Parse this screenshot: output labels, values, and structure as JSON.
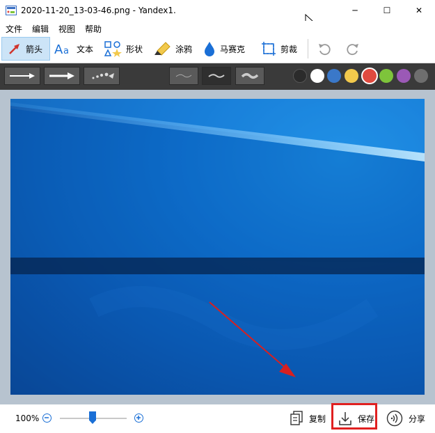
{
  "window": {
    "title": "2020-11-20_13-03-46.png - Yandex1.",
    "controls": {
      "minimize": "─",
      "maximize": "☐",
      "close": "✕"
    }
  },
  "menu": [
    {
      "label": "文件"
    },
    {
      "label": "编辑"
    },
    {
      "label": "视图"
    },
    {
      "label": "帮助"
    }
  ],
  "toolbar": {
    "tools": [
      {
        "label": "箭头",
        "icon": "arrow-tool-icon",
        "active": true
      },
      {
        "label": "文本",
        "icon": "text-tool-icon"
      },
      {
        "label": "形状",
        "icon": "shape-tool-icon"
      },
      {
        "label": "涂鸦",
        "icon": "marker-tool-icon"
      },
      {
        "label": "马赛克",
        "icon": "mosaic-tool-icon"
      },
      {
        "label": "剪裁",
        "icon": "crop-tool-icon"
      }
    ],
    "undo_icon": "undo-icon",
    "redo_icon": "redo-icon"
  },
  "options": {
    "arrow_styles": [
      "thin-arrow",
      "thick-arrow",
      "dotted-arrow"
    ],
    "line_widths": [
      "thin",
      "medium",
      "thick"
    ],
    "selected_line_width": "medium",
    "colors": [
      "#2b2b2b",
      "#ffffff",
      "#3a78c9",
      "#f2c94c",
      "#e04a3f",
      "#7ec43b",
      "#9b59b6",
      "#6e6e6e"
    ],
    "selected_color": "#e04a3f"
  },
  "status": {
    "zoom": "100%",
    "zoom_level": 0.5,
    "actions": [
      {
        "label": "复制",
        "icon": "copy-icon"
      },
      {
        "label": "保存",
        "icon": "download-icon"
      },
      {
        "label": "分享",
        "icon": "share-icon"
      }
    ]
  }
}
